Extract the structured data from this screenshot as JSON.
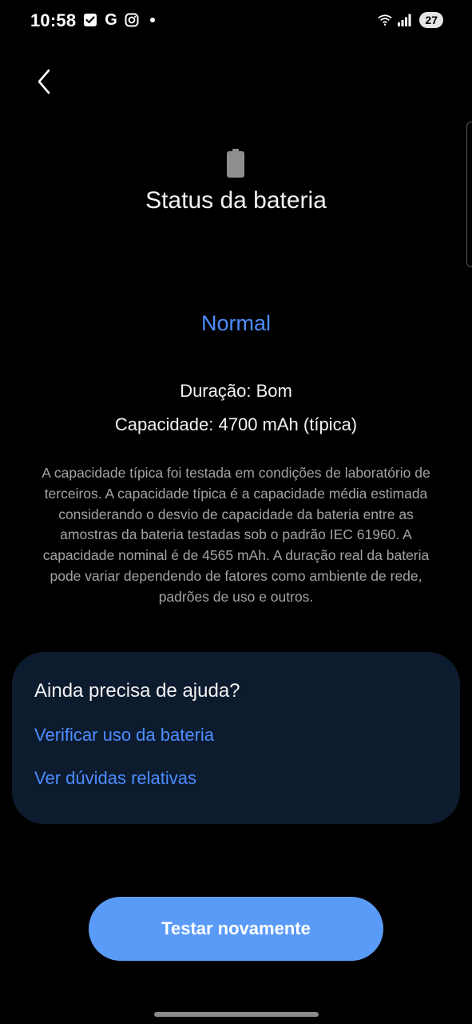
{
  "status_bar": {
    "time": "10:58",
    "left_icons": [
      "checkbox-icon",
      "google-icon",
      "instagram-icon",
      "dot-icon"
    ],
    "google_glyph": "G",
    "right_icons": [
      "wifi-icon",
      "signal-icon"
    ],
    "battery_level": "27"
  },
  "header": {
    "back_icon": "chevron-left-icon",
    "title": "Status da bateria"
  },
  "battery_status": {
    "status": "Normal",
    "duration": "Duração: Bom",
    "capacity": "Capacidade: 4700 mAh (típica)",
    "description": "A capacidade típica foi testada em condições de laboratório de terceiros. A capacidade típica é a capacidade média estimada considerando o desvio de capacidade da bateria entre as amostras da bateria testadas sob o padrão IEC 61960. A capacidade nominal é de 4565 mAh. A duração real da bateria pode variar dependendo de fatores como ambiente de rede, padrões de uso e outros."
  },
  "help_card": {
    "title": "Ainda precisa de ajuda?",
    "links": [
      {
        "label": "Verificar uso da bateria"
      },
      {
        "label": "Ver dúvidas relativas"
      }
    ]
  },
  "actions": {
    "retest_label": "Testar novamente"
  },
  "colors": {
    "background": "#000000",
    "accent": "#4c8dff",
    "button": "#5b9bf8",
    "card": "#0d1b2e",
    "muted_text": "#a3a3a3"
  }
}
